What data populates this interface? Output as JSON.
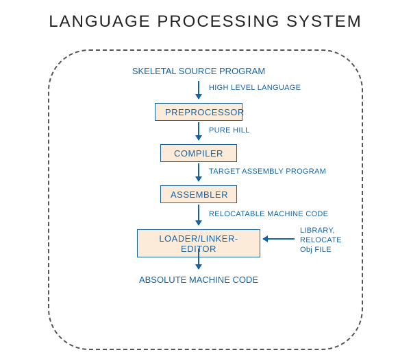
{
  "title": "LANGUAGE PROCESSING SYSTEM",
  "colors": {
    "text": "#1463a6",
    "boxFill": "#fdebda",
    "boxBorder": "#1463a6",
    "frame": "#555"
  },
  "nodes": {
    "start": "SKELETAL SOURCE PROGRAM",
    "preprocessor": "PREPROCESSOR",
    "compiler": "COMPILER",
    "assembler": "ASSEMBLER",
    "loader": "LOADER/LINKER-EDITOR",
    "end": "ABSOLUTE MACHINE CODE"
  },
  "edges": {
    "e1": "HIGH LEVEL LANGUAGE",
    "e2": "PURE HILL",
    "e3": "TARGET ASSEMBLY PROGRAM",
    "e4": "RELOCATABLE MACHINE CODE",
    "side": "LIBRARY,\nRELOCATE\nObj FILE"
  }
}
